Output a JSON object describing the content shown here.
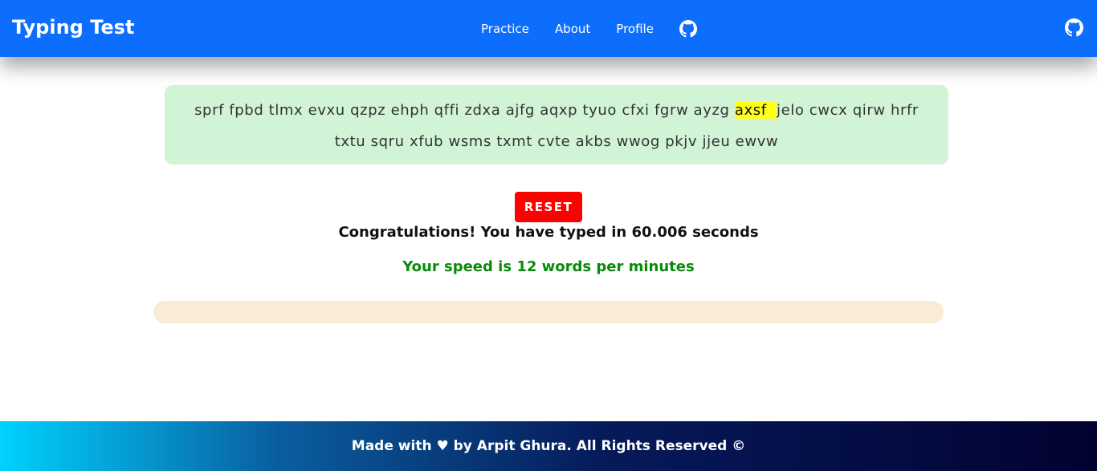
{
  "navbar": {
    "brand": "Typing Test",
    "links": [
      "Practice",
      "About",
      "Profile"
    ],
    "github_icon": "github-icon",
    "bg_color": "#0d6efd"
  },
  "paragraph": {
    "before_highlight": "sprf fpbd tlmx evxu qzpz ehph qffi zdxa ajfg aqxp tyuo cfxi fgrw ayzg ",
    "highlight": "axsf ",
    "after_highlight": "jelo cwcx qirw hrfr txtu sqru xfub wsms txmt cvte akbs wwog pkjv jjeu ewvw",
    "bg_color": "#d1f4d6",
    "highlight_color": "#ffff1a"
  },
  "controls": {
    "reset_label": "RESET",
    "reset_color": "#ff0000"
  },
  "result": {
    "congrats": "Congratulations! You have typed in 60.006 seconds",
    "speed": "Your speed is 12 words per minutes",
    "speed_color": "#0a8a0a"
  },
  "input": {
    "value": "",
    "placeholder": ""
  },
  "footer": {
    "text": "Made with ♥ by Arpit Ghura. All Rights Reserved ©"
  }
}
